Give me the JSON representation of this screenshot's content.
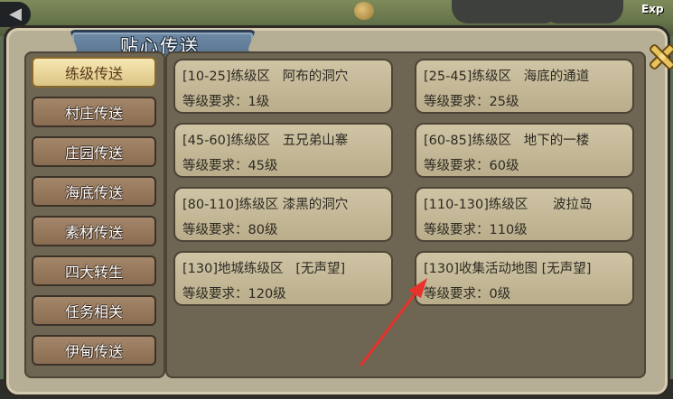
{
  "window": {
    "title": "贴心传送",
    "exp_label": "Exp"
  },
  "sidebar": {
    "items": [
      {
        "label": "练级传送",
        "active": true
      },
      {
        "label": "村庄传送",
        "active": false
      },
      {
        "label": "庄园传送",
        "active": false
      },
      {
        "label": "海底传送",
        "active": false
      },
      {
        "label": "素材传送",
        "active": false
      },
      {
        "label": "四大转生",
        "active": false
      },
      {
        "label": "任务相关",
        "active": false
      },
      {
        "label": "伊甸传送",
        "active": false
      }
    ]
  },
  "destinations": [
    {
      "title": "[10-25]练级区   阿布的洞穴",
      "requirement": "等级要求：1级"
    },
    {
      "title": "[25-45]练级区   海底的通道",
      "requirement": "等级要求：25级"
    },
    {
      "title": "[45-60]练级区   五兄弟山寨",
      "requirement": "等级要求：45级"
    },
    {
      "title": "[60-85]练级区   地下的一楼",
      "requirement": "等级要求：60级"
    },
    {
      "title": "[80-110]练级区 漆黑的洞穴",
      "requirement": "等级要求：80级"
    },
    {
      "title": "[110-130]练级区      波拉岛",
      "requirement": "等级要求：110级"
    },
    {
      "title": "[130]地城练级区   [无声望]",
      "requirement": "等级要求：120级"
    },
    {
      "title": "[130]收集活动地图 [无声望]",
      "requirement": "等级要求：0级"
    }
  ],
  "colors": {
    "arrow": "#e8322c",
    "title_banner": "#5b7896",
    "active_tab": "#f0dea4"
  }
}
